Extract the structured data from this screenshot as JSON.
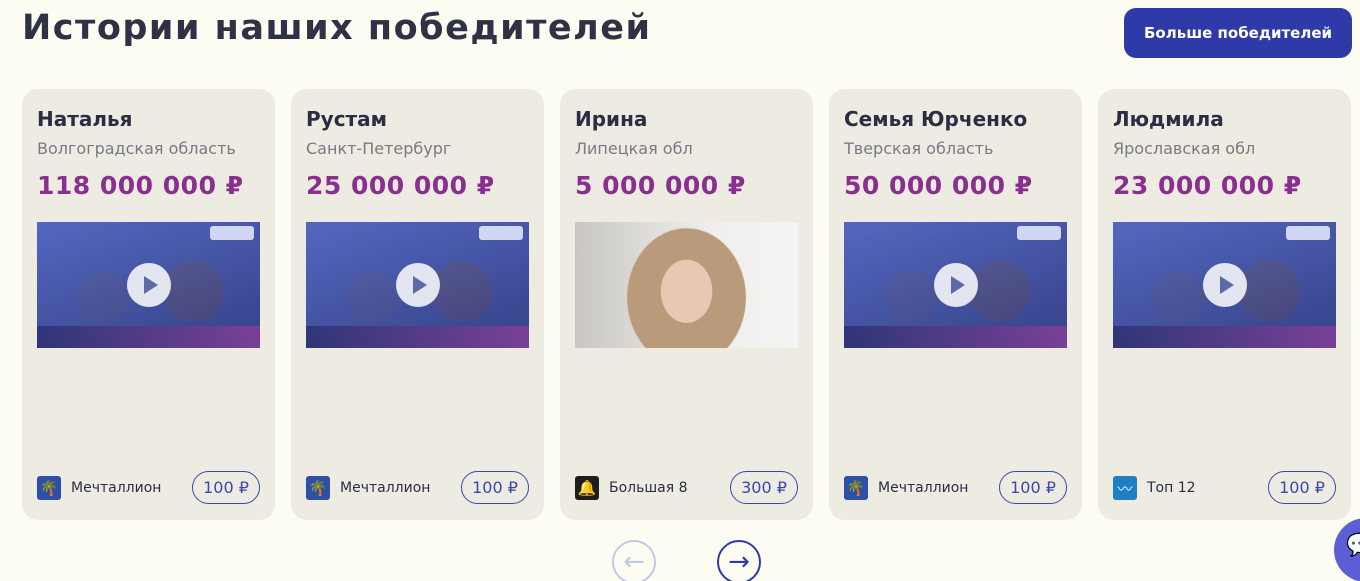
{
  "header": {
    "title": "Истории наших победителей",
    "more_label": "Больше победителей"
  },
  "colors": {
    "accent": "#2d3aa8",
    "prize": "#8a2e8f",
    "card_bg": "#edebe2",
    "page_bg": "#fcfcf2"
  },
  "winners": [
    {
      "name": "Наталья",
      "region": "Волгоградская область",
      "prize": "118 000 000 ₽",
      "media": "video",
      "lottery": "Мечталлион",
      "lottery_icon": "palm-icon",
      "price": "100 ₽"
    },
    {
      "name": "Рустам",
      "region": "Санкт-Петербург",
      "prize": "25 000 000 ₽",
      "media": "video",
      "lottery": "Мечталлион",
      "lottery_icon": "palm-icon",
      "price": "100 ₽"
    },
    {
      "name": "Ирина",
      "region": "Липецкая обл",
      "prize": "5 000 000 ₽",
      "media": "photo",
      "lottery": "Большая 8",
      "lottery_icon": "bell-icon",
      "price": "300 ₽"
    },
    {
      "name": "Семья Юрченко",
      "region": "Тверская область",
      "prize": "50 000 000 ₽",
      "media": "video",
      "lottery": "Мечталлион",
      "lottery_icon": "palm-icon",
      "price": "100 ₽"
    },
    {
      "name": "Людмила",
      "region": "Ярославская обл",
      "prize": "23 000 000 ₽",
      "media": "video",
      "lottery": "Топ 12",
      "lottery_icon": "wave-icon",
      "price": "100 ₽"
    }
  ],
  "navigation": {
    "prev_icon": "arrow-left-icon",
    "next_icon": "arrow-right-icon",
    "prev_glyph": "←",
    "next_glyph": "→"
  },
  "chat": {
    "icon": "chat-icon",
    "glyph": "💬"
  }
}
